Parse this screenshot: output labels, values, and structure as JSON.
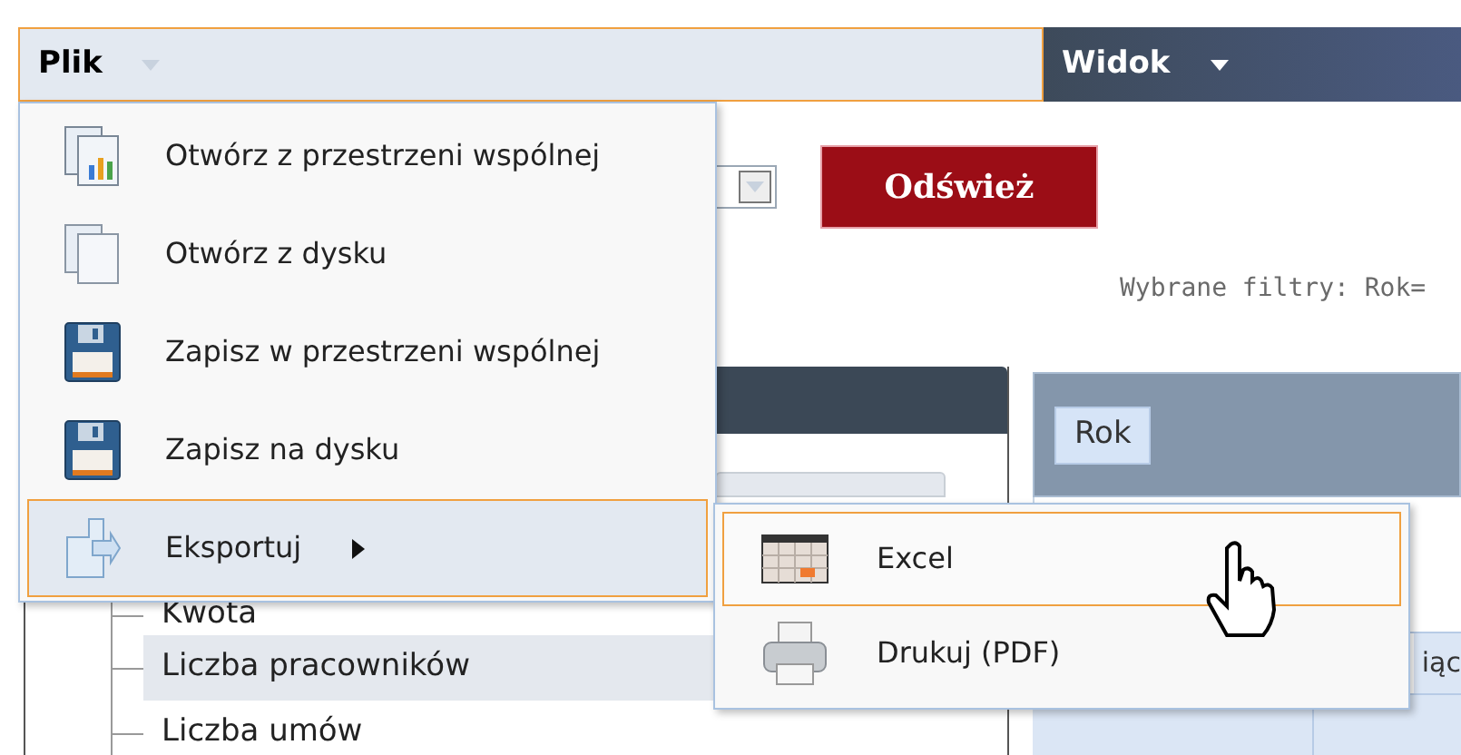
{
  "menubar": [
    {
      "label": "Plik",
      "open": true
    },
    {
      "label": "Widok",
      "open": false
    }
  ],
  "toolbar": {
    "refresh_button": "Odśwież"
  },
  "filters_text": "Wybrane filtry: Rok=",
  "tree": {
    "items": [
      {
        "label": "Kwota",
        "selected": false
      },
      {
        "label": "Liczba pracowników",
        "selected": true
      },
      {
        "label": "Liczba umów",
        "selected": false
      }
    ]
  },
  "pivot": {
    "row_fields": [
      "Rok"
    ],
    "column_header": "iąc"
  },
  "file_menu": {
    "items": [
      {
        "label": "Otwórz z przestrzeni wspólnej",
        "kind": "chartdoc",
        "highlighted": false,
        "submenu": false
      },
      {
        "label": "Otwórz z dysku",
        "kind": "doc",
        "highlighted": false,
        "submenu": false
      },
      {
        "label": "Zapisz w przestrzeni wspólnej",
        "kind": "floppy",
        "highlighted": false,
        "submenu": false
      },
      {
        "label": "Zapisz na dysku",
        "kind": "floppy",
        "highlighted": false,
        "submenu": false
      },
      {
        "label": "Eksportuj",
        "kind": "export",
        "highlighted": true,
        "submenu": true
      }
    ]
  },
  "export_submenu": {
    "items": [
      {
        "label": "Excel",
        "kind": "spreadsheet",
        "highlighted": true
      },
      {
        "label": "Drukuj (PDF)",
        "kind": "printer",
        "highlighted": false
      }
    ]
  }
}
